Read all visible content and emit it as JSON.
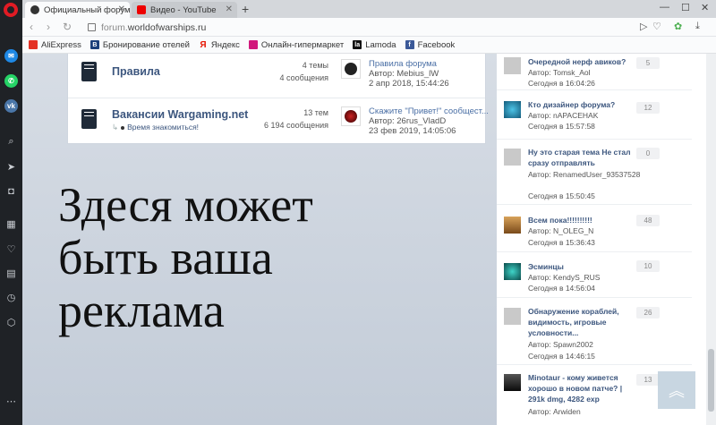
{
  "browser": {
    "tabs": [
      {
        "title": "Официальный форум игры",
        "active": true
      },
      {
        "title": "Видео - YouTube",
        "active": false
      }
    ],
    "new_tab_symbol": "+",
    "window_controls": [
      "—",
      "☐",
      "✕"
    ],
    "url_host": "forum.",
    "url_domain": "worldofwarships.ru",
    "bookmarks": [
      {
        "label": "AliExpress",
        "icon": "aliexpress-icon",
        "color": "#e43225"
      },
      {
        "label": "Бронирование отелей",
        "icon": "booking-icon",
        "color": "#1a3e7a"
      },
      {
        "label": "Яндекс",
        "icon": "yandex-icon",
        "color": "#e61400"
      },
      {
        "label": "Онлайн-гипермаркет",
        "icon": "hypermarket-icon",
        "color": "#d1187c"
      },
      {
        "label": "Lamoda",
        "icon": "lamoda-icon",
        "color": "#111111"
      },
      {
        "label": "Facebook",
        "icon": "facebook-icon",
        "color": "#3b5998"
      }
    ]
  },
  "forums": [
    {
      "title": "Правила",
      "topics": "4 темы",
      "posts": "4 сообщения",
      "last_topic": "Правила форума",
      "last_author": "Автор: Mebius_lW",
      "last_date": "2 апр 2018, 15:44:26",
      "subforum": ""
    },
    {
      "title": "Вакансии Wargaming.net",
      "topics": "13 тем",
      "posts": "6 194 сообщения",
      "last_topic": "Скажите \"Привет!\" сообщест...",
      "last_author": "Автор: 26rus_VladD",
      "last_date": "23 фев 2019, 14:05:06",
      "subforum": "Время знакомиться!"
    }
  ],
  "ad": {
    "text": "Здеся может быть ваша реклама"
  },
  "activity": [
    {
      "title": "Очередной нерф авиков?",
      "author": "Автор: Tomsk_Aol",
      "date": "Сегодня в 16:04:26",
      "count": "5"
    },
    {
      "title": "Кто дизайнер форума?",
      "author": "Автор: nAPACEHAK",
      "date": "Сегодня в 15:57:58",
      "count": "12"
    },
    {
      "title": "Ну это старая тема Не стал сразу отправлять",
      "author": "Автор: RenamedUser_93537528",
      "date": "Сегодня в 15:50:45",
      "count": "0"
    },
    {
      "title": "Всем пока!!!!!!!!!!",
      "author": "Автор: N_OLEG_N",
      "date": "Сегодня в 15:36:43",
      "count": "48"
    },
    {
      "title": "Эсминцы",
      "author": "Автор: KendyS_RUS",
      "date": "Сегодня в 14:56:04",
      "count": "10"
    },
    {
      "title": "Обнаружение кораблей, видимость, игровые условности...",
      "author": "Автор: Spawn2002",
      "date": "Сегодня в 14:46:15",
      "count": "26"
    },
    {
      "title": "Minotaur - кому живется хорошо в новом патче? | 291k dmg, 4282 exp",
      "author": "Автор: Arwiden",
      "date": "",
      "count": "13"
    }
  ]
}
